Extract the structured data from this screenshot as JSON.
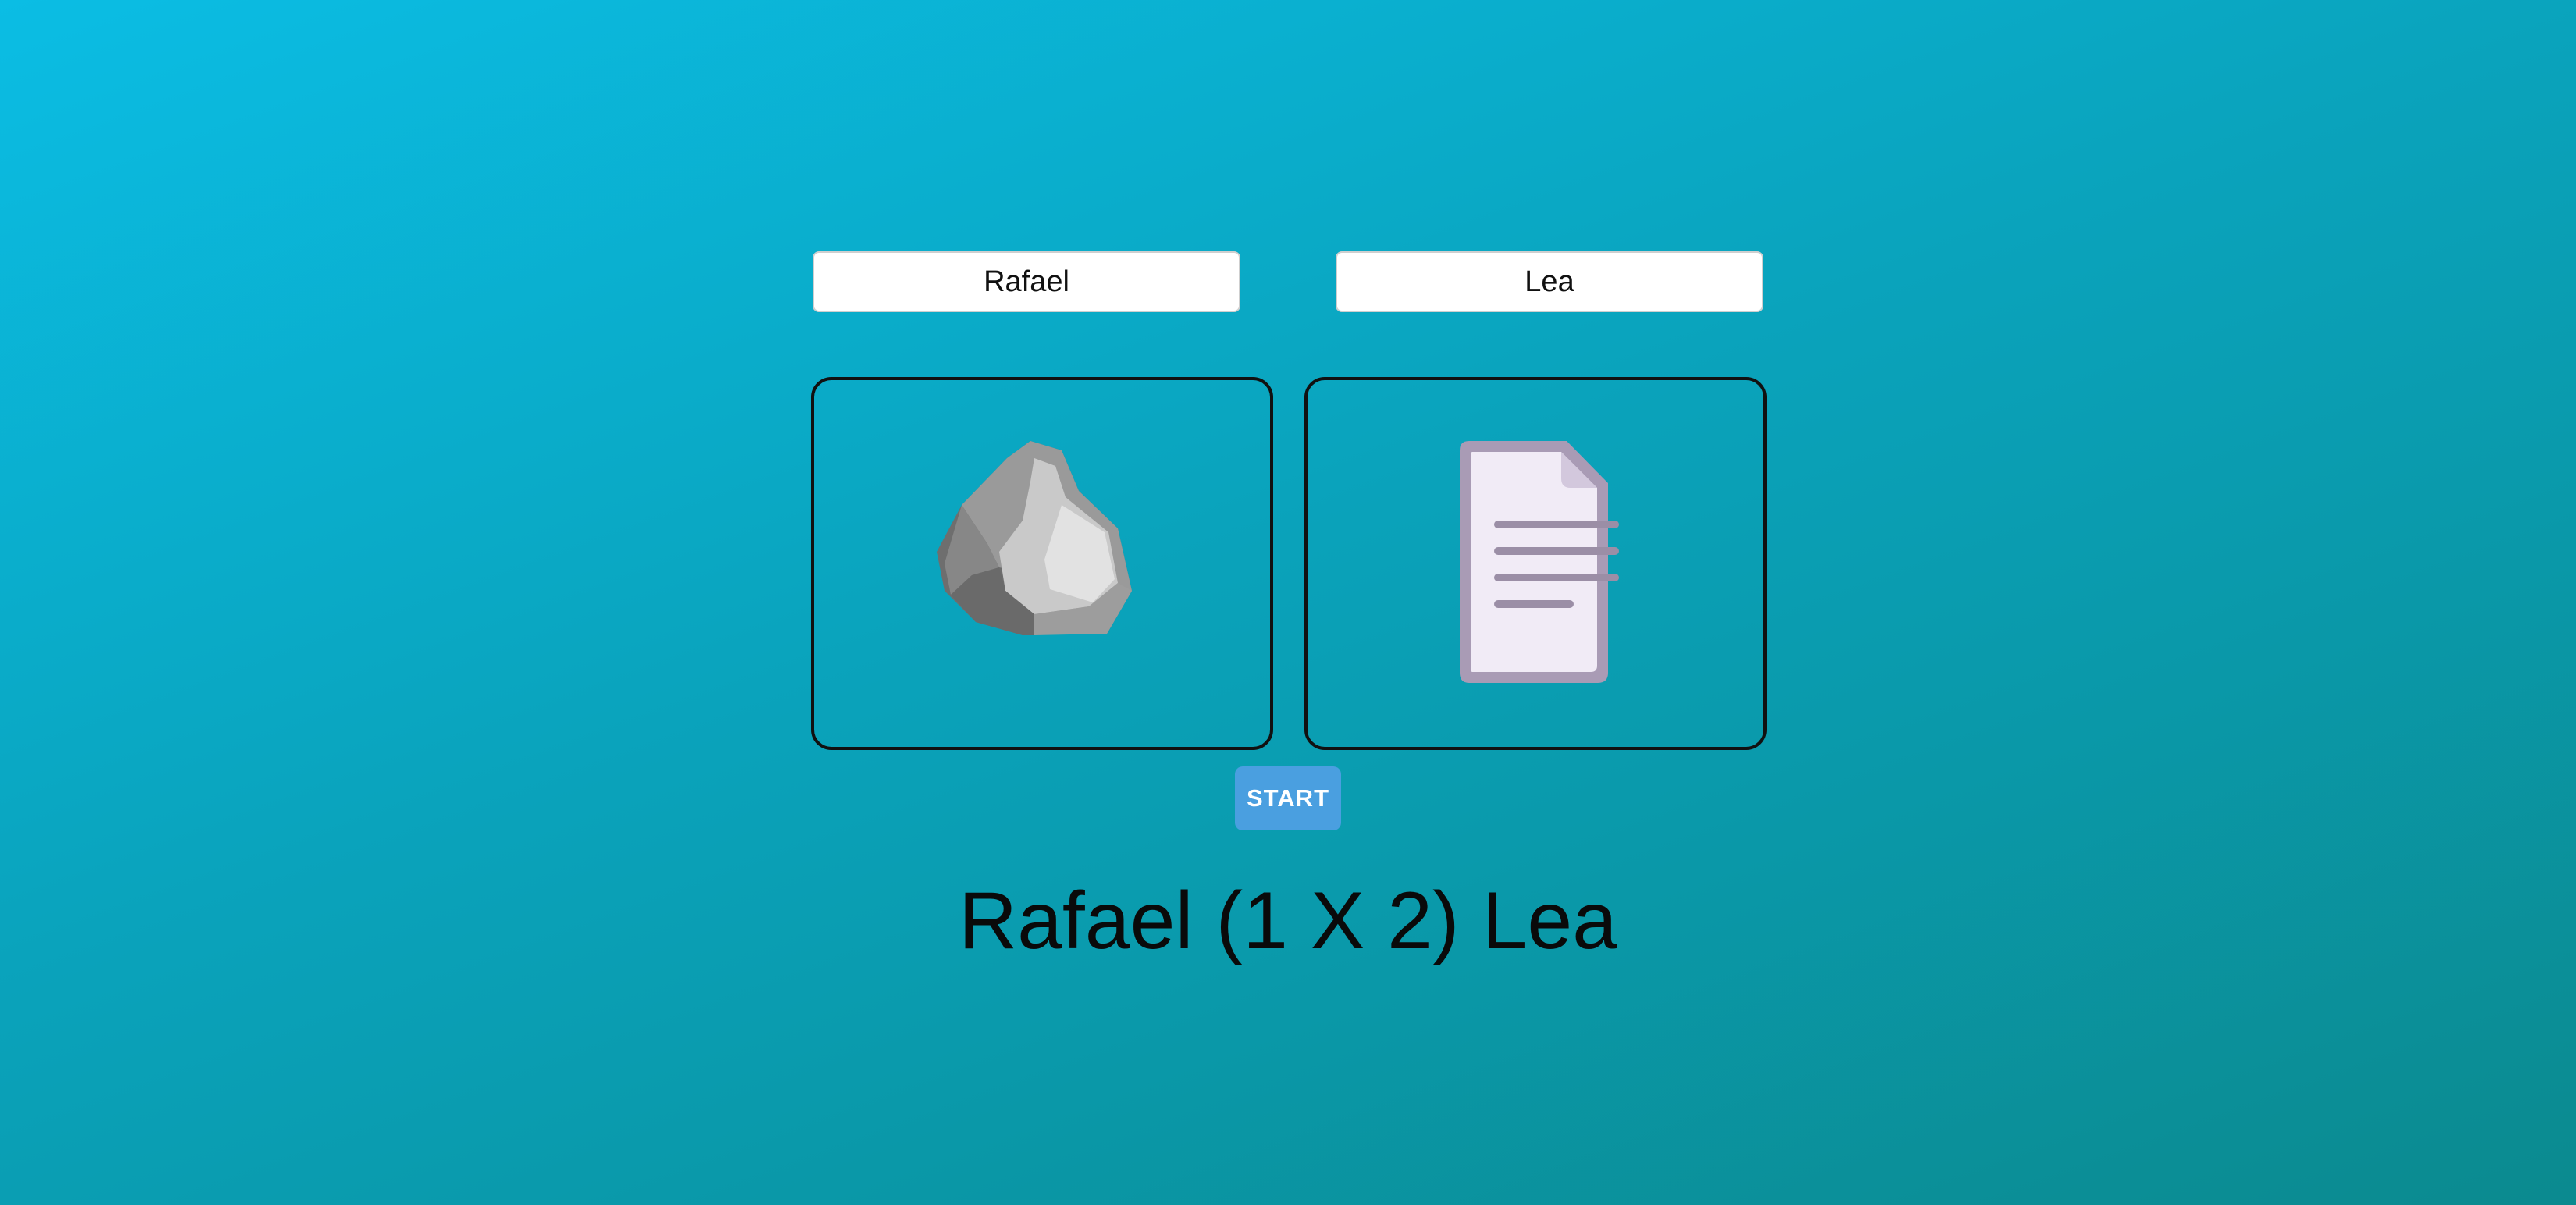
{
  "players": {
    "player1": {
      "name": "Rafael"
    },
    "player2": {
      "name": "Lea"
    }
  },
  "choices": {
    "player1": {
      "icon": "rock-icon"
    },
    "player2": {
      "icon": "paper-icon"
    }
  },
  "controls": {
    "start_label": "START"
  },
  "score": {
    "text": "Rafael (1 X 2) Lea"
  },
  "colors": {
    "start_button": "#4a9fe0",
    "card_border": "#111111"
  }
}
